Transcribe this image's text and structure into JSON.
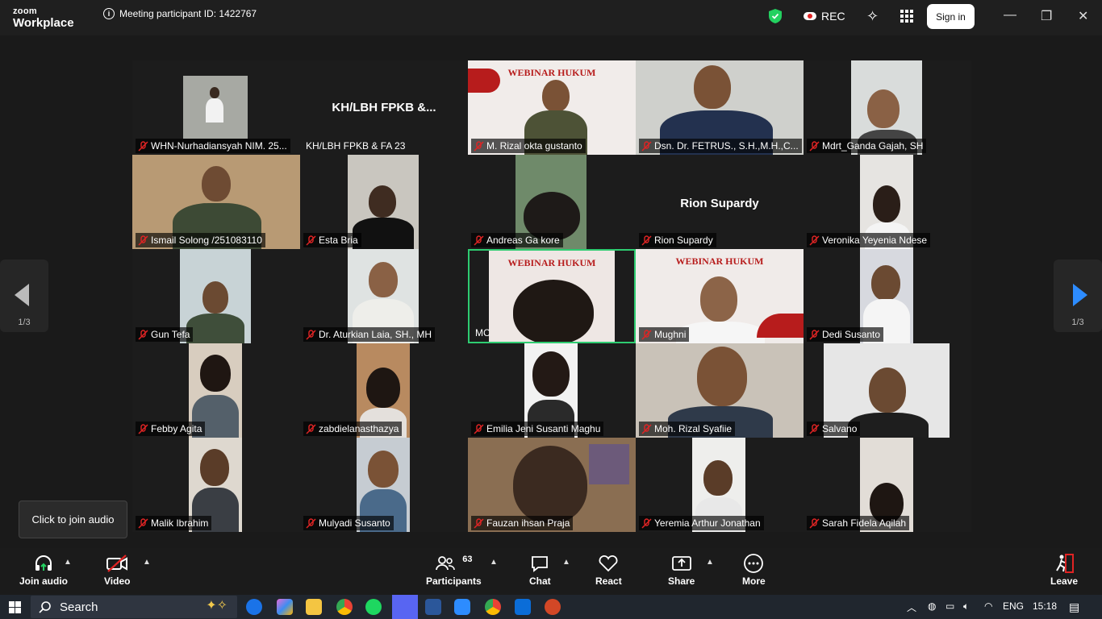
{
  "app": {
    "brand_top": "zoom",
    "brand_bottom": "Workplace"
  },
  "meeting": {
    "participant_id_label": "Meeting participant ID: 1422767"
  },
  "topbar": {
    "rec_label": "REC",
    "signin_label": "Sign in",
    "minimize": "—",
    "restore": "❐",
    "close": "✕"
  },
  "banner": {
    "title": "WEBINAR HUKUM"
  },
  "tiles": [
    {
      "name": "WHN-Nurhadiansyah NIM. 25...",
      "muted": true
    },
    {
      "name": "KH/LBH FPKB & FA 23",
      "big_name": "KH/LBH FPKB &...",
      "muted": false
    },
    {
      "name": "M. Rizal okta gustanto",
      "muted": true
    },
    {
      "name": "Dsn. Dr. FETRUS., S.H.,M.H.,C...",
      "muted": true
    },
    {
      "name": "Mdrt_Ganda Gajah, SH",
      "muted": true
    },
    {
      "name": "Ismail Solong /251083110",
      "muted": true
    },
    {
      "name": "Esta Bria",
      "muted": true
    },
    {
      "name": "Andreas Ga kore",
      "muted": true
    },
    {
      "name": "Rion Supardy",
      "big_name": "Rion Supardy",
      "muted": true
    },
    {
      "name": "Veronika Yeyenia Ndese",
      "muted": true
    },
    {
      "name": "Gun Tefa",
      "muted": true
    },
    {
      "name": "Dr. Aturkian Laia, SH., MH",
      "muted": true
    },
    {
      "name": "MC",
      "muted": false
    },
    {
      "name": "Mughni",
      "muted": true
    },
    {
      "name": "Dedi Susanto",
      "muted": true
    },
    {
      "name": "Febby Agita",
      "muted": true
    },
    {
      "name": "zabdielanasthazya",
      "muted": true
    },
    {
      "name": "Emilia Jeni Susanti Maghu",
      "muted": true
    },
    {
      "name": "Moh. Rizal Syafiie",
      "muted": true
    },
    {
      "name": "Salvano",
      "muted": true
    },
    {
      "name": "Malik Ibrahim",
      "muted": true
    },
    {
      "name": "Mulyadi Susanto",
      "muted": true
    },
    {
      "name": "Fauzan ihsan Praja",
      "muted": true
    },
    {
      "name": "Yeremia Arthur Jonathan",
      "muted": true
    },
    {
      "name": "Sarah Fidela Aqilah",
      "muted": true
    }
  ],
  "pagination": {
    "left": "1/3",
    "right": "1/3"
  },
  "tooltip": {
    "text": "Click to join audio"
  },
  "toolbar": {
    "join_audio": "Join audio",
    "video": "Video",
    "participants": "Participants",
    "participants_count": "63",
    "chat": "Chat",
    "react": "React",
    "share": "Share",
    "more": "More",
    "leave": "Leave"
  },
  "taskbar": {
    "search_label": "Search",
    "lang": "ENG",
    "time": "15:18"
  },
  "colors": {
    "active_speaker": "#2ecc71",
    "mute_red": "#e02424",
    "share_green": "#23d160",
    "leave_red": "#e02424"
  }
}
